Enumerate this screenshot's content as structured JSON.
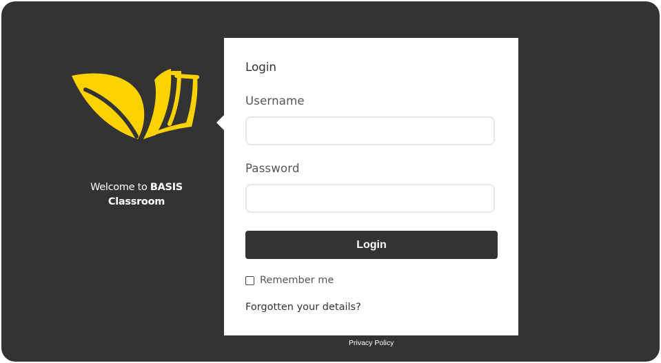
{
  "brand": {
    "logo_icon": "leaf-and-book-icon",
    "logo_color": "#f9d200",
    "welcome_prefix": "Welcome to ",
    "welcome_name": "BASIS",
    "welcome_suffix": "Classroom"
  },
  "login": {
    "title": "Login",
    "username_label": "Username",
    "username_value": "",
    "password_label": "Password",
    "password_value": "",
    "submit_label": "Login",
    "remember_label": "Remember me",
    "remember_checked": false,
    "forgot_link": "Forgotten your details?"
  },
  "footer": {
    "privacy_link": "Privacy Policy"
  },
  "colors": {
    "background": "#333333",
    "panel": "#ffffff",
    "accent": "#f9d200",
    "button": "#333333"
  }
}
